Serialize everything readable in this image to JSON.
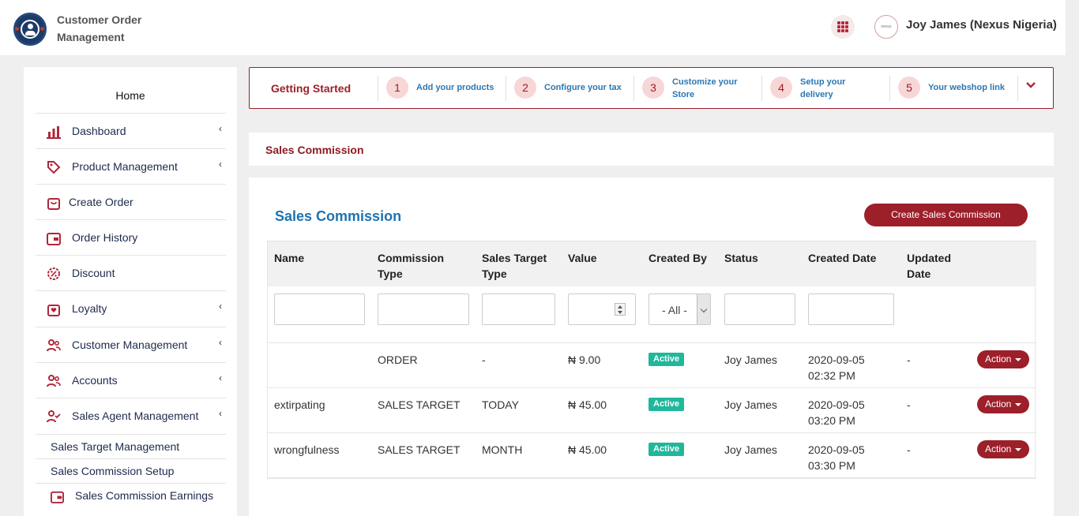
{
  "header": {
    "app_title": "Customer Order Management",
    "user_name": "Joy James (Nexus Nigeria)",
    "avatar_text": "nexus"
  },
  "sidebar": {
    "home": "Home",
    "items": [
      {
        "label": "Dashboard",
        "icon": "bar-chart-icon",
        "has_submenu": true
      },
      {
        "label": "Product Management",
        "icon": "tag-icon",
        "has_submenu": true
      },
      {
        "label": "Create Order",
        "icon": "shopping-bag-icon",
        "has_submenu": false
      },
      {
        "label": "Order History",
        "icon": "wallet-icon",
        "has_submenu": false
      },
      {
        "label": "Discount",
        "icon": "discount-icon",
        "has_submenu": false
      },
      {
        "label": "Loyalty",
        "icon": "loyalty-bag-icon",
        "has_submenu": true
      },
      {
        "label": "Customer Management",
        "icon": "users-icon",
        "has_submenu": true
      },
      {
        "label": "Accounts",
        "icon": "users-icon",
        "has_submenu": true
      },
      {
        "label": "Sales Agent Management",
        "icon": "user-check-icon",
        "has_submenu": true
      }
    ],
    "sub_items": [
      {
        "label": "Sales Target Management"
      },
      {
        "label": "Sales Commission Setup"
      },
      {
        "label": "Sales Commission Earnings",
        "icon": "wallet-icon"
      }
    ],
    "chevron": "‹"
  },
  "getting_started": {
    "title": "Getting Started",
    "steps": [
      {
        "num": "1",
        "label": "Add your products"
      },
      {
        "num": "2",
        "label": "Configure your tax"
      },
      {
        "num": "3",
        "label": "Customize your Store"
      },
      {
        "num": "4",
        "label": "Setup your delivery"
      },
      {
        "num": "5",
        "label": "Your webshop link"
      }
    ]
  },
  "breadcrumb": {
    "title": "Sales Commission"
  },
  "card": {
    "title": "Sales Commission",
    "create_button": "Create Sales Commission"
  },
  "table": {
    "columns": [
      "Name",
      "Commission Type",
      "Sales Target Type",
      "Value",
      "Created By",
      "Status",
      "Created Date",
      "Updated Date"
    ],
    "filter_select": "- All -",
    "action_label": "Action",
    "rows": [
      {
        "name": "",
        "commission_type": "ORDER",
        "target_type": "-",
        "value": "₦ 9.00",
        "status": "Active",
        "created_by": "Joy James",
        "created_date": "2020-09-05 02:32 PM",
        "updated_date": "-"
      },
      {
        "name": "extirpating",
        "commission_type": "SALES TARGET",
        "target_type": "TODAY",
        "value": "₦ 45.00",
        "status": "Active",
        "created_by": "Joy James",
        "created_date": "2020-09-05 03:20 PM",
        "updated_date": "-"
      },
      {
        "name": "wrongfulness",
        "commission_type": "SALES TARGET",
        "target_type": "MONTH",
        "value": "₦ 45.00",
        "status": "Active",
        "created_by": "Joy James",
        "created_date": "2020-09-05 03:30 PM",
        "updated_date": "-"
      }
    ]
  },
  "colors": {
    "brand": "#9c1f2a",
    "link": "#1d73b0",
    "status_active": "#1fb89a",
    "nav_text": "#1d2a4d"
  }
}
